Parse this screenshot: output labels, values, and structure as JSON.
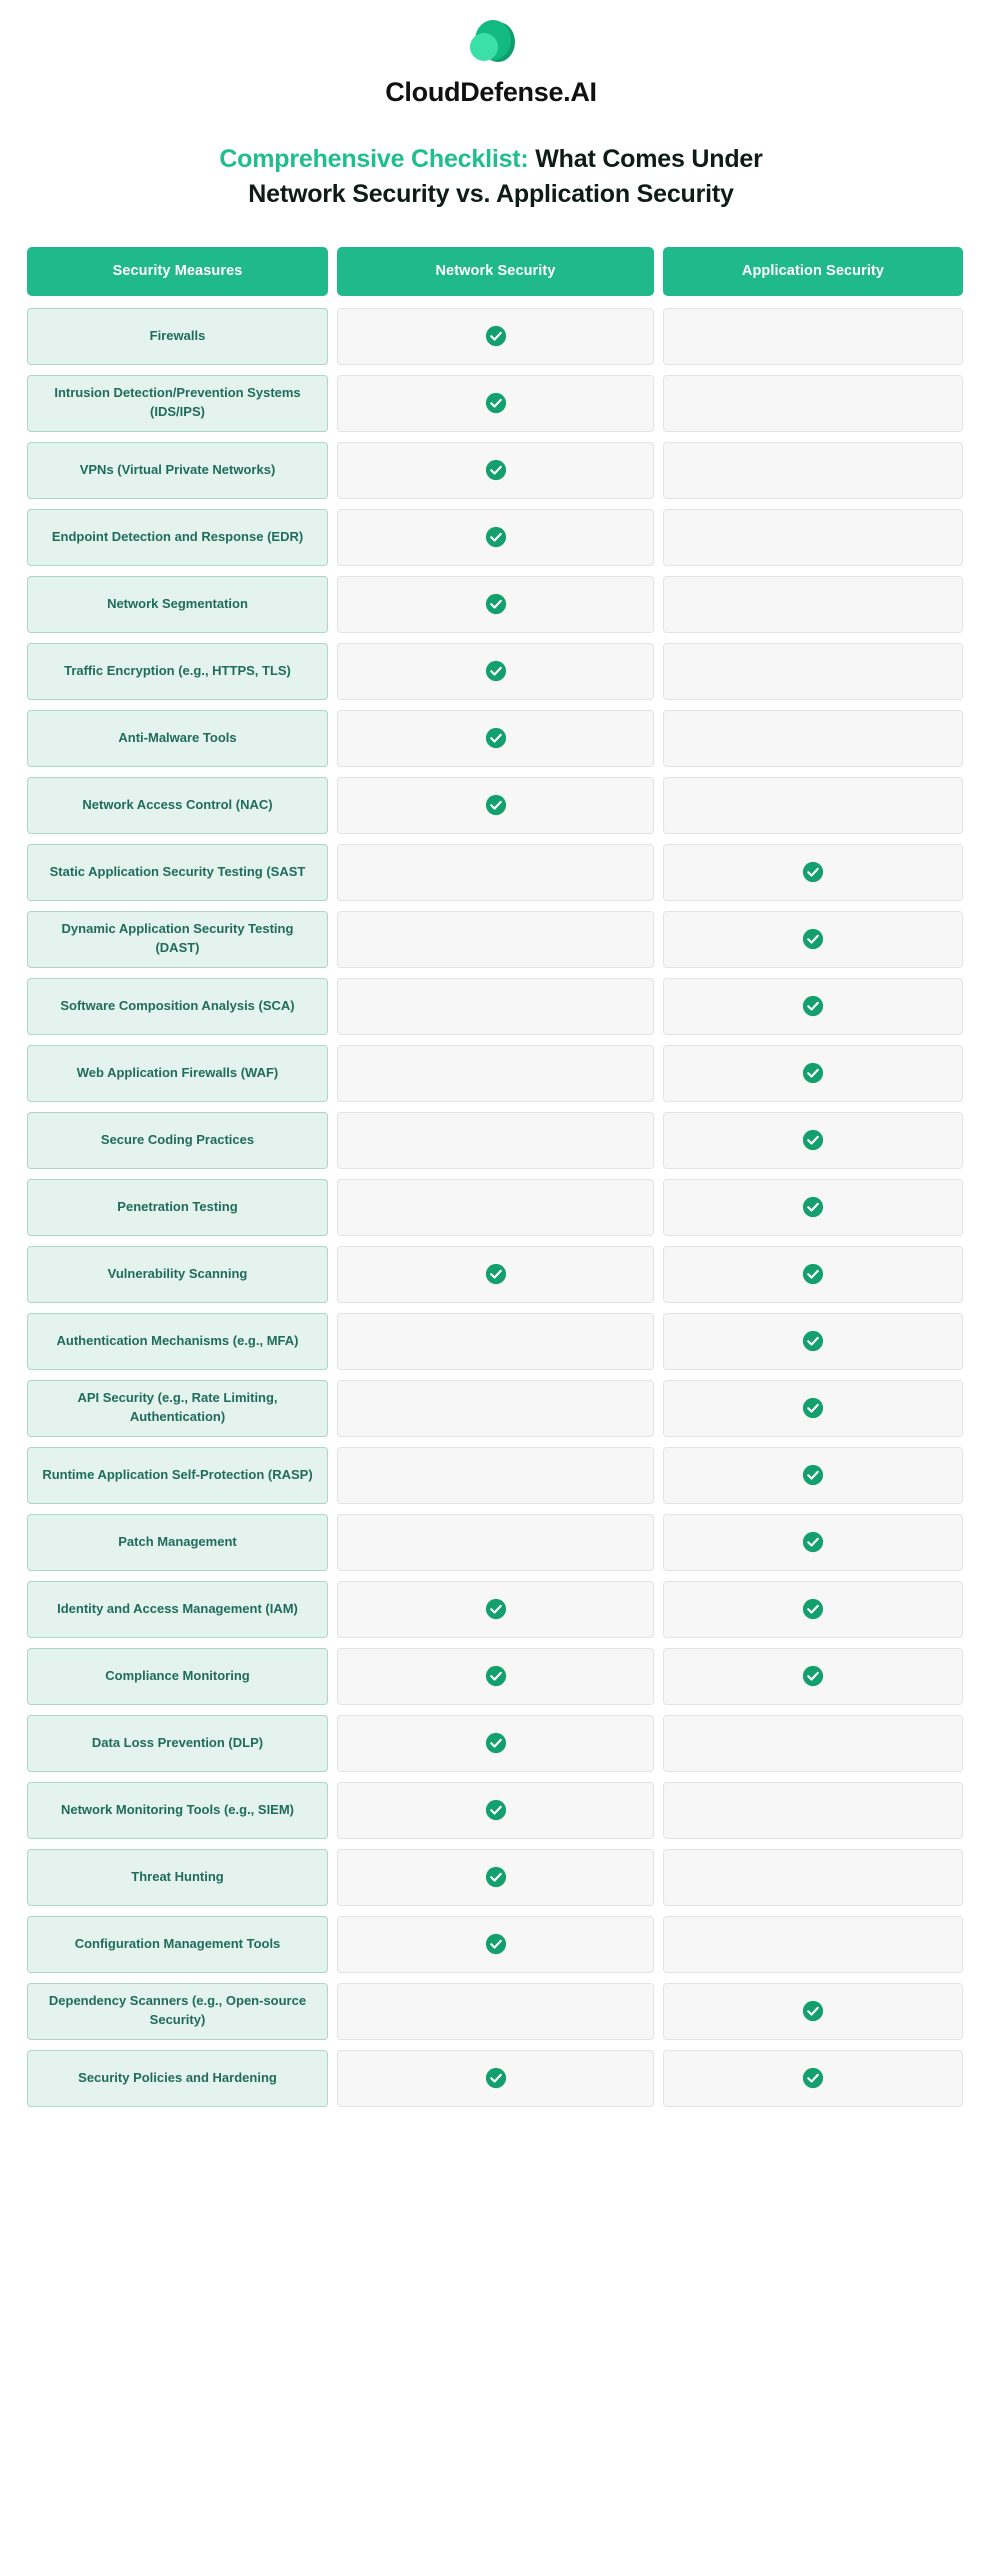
{
  "brand": {
    "name": "CloudDefense.AI",
    "logo_icon": "cloud-logo-icon",
    "logo_colors": [
      "#2FDBA0",
      "#12B981",
      "#0E9E6E"
    ]
  },
  "title": {
    "accent_text": "Comprehensive Checklist:",
    "rest_text": " What Comes Under",
    "line2": "Network Security vs. Application Security",
    "accent_color": "#1EBE8F"
  },
  "colors": {
    "header_green": "#1FB98C",
    "measure_bg": "#E4F3ED",
    "measure_border": "#A9D8C8",
    "measure_text": "#1F6C5C",
    "mark_bg": "#F6F7F6",
    "mark_border": "#E2E4E2",
    "check_green": "#13A06E"
  },
  "table": {
    "columns": [
      "Security Measures",
      "Network Security",
      "Application Security"
    ],
    "check_icon": "check-circle-icon",
    "rows": [
      {
        "measure": "Firewalls",
        "network": true,
        "application": false
      },
      {
        "measure": "Intrusion Detection/Prevention Systems (IDS/IPS)",
        "network": true,
        "application": false
      },
      {
        "measure": "VPNs (Virtual Private Networks)",
        "network": true,
        "application": false
      },
      {
        "measure": "Endpoint Detection and Response (EDR)",
        "network": true,
        "application": false
      },
      {
        "measure": "Network Segmentation",
        "network": true,
        "application": false
      },
      {
        "measure": "Traffic Encryption (e.g., HTTPS, TLS)",
        "network": true,
        "application": false
      },
      {
        "measure": "Anti-Malware Tools",
        "network": true,
        "application": false
      },
      {
        "measure": "Network Access Control (NAC)",
        "network": true,
        "application": false
      },
      {
        "measure": "Static Application Security Testing (SAST",
        "network": false,
        "application": true
      },
      {
        "measure": "Dynamic Application Security Testing (DAST)",
        "network": false,
        "application": true
      },
      {
        "measure": "Software Composition Analysis (SCA)",
        "network": false,
        "application": true
      },
      {
        "measure": "Web Application Firewalls (WAF)",
        "network": false,
        "application": true
      },
      {
        "measure": "Secure Coding Practices",
        "network": false,
        "application": true
      },
      {
        "measure": "Penetration Testing",
        "network": false,
        "application": true
      },
      {
        "measure": "Vulnerability Scanning",
        "network": true,
        "application": true
      },
      {
        "measure": "Authentication Mechanisms (e.g., MFA)",
        "network": false,
        "application": true
      },
      {
        "measure": "API Security (e.g., Rate Limiting, Authentication)",
        "network": false,
        "application": true
      },
      {
        "measure": "Runtime Application Self-Protection (RASP)",
        "network": false,
        "application": true
      },
      {
        "measure": "Patch Management",
        "network": false,
        "application": true
      },
      {
        "measure": "Identity and Access Management (IAM)",
        "network": true,
        "application": true
      },
      {
        "measure": "Compliance Monitoring",
        "network": true,
        "application": true
      },
      {
        "measure": "Data Loss Prevention (DLP)",
        "network": true,
        "application": false
      },
      {
        "measure": "Network Monitoring Tools (e.g., SIEM)",
        "network": true,
        "application": false
      },
      {
        "measure": "Threat Hunting",
        "network": true,
        "application": false
      },
      {
        "measure": "Configuration Management Tools",
        "network": true,
        "application": false
      },
      {
        "measure": "Dependency Scanners (e.g., Open-source Security)",
        "network": false,
        "application": true
      },
      {
        "measure": "Security Policies and Hardening",
        "network": true,
        "application": true
      }
    ]
  }
}
